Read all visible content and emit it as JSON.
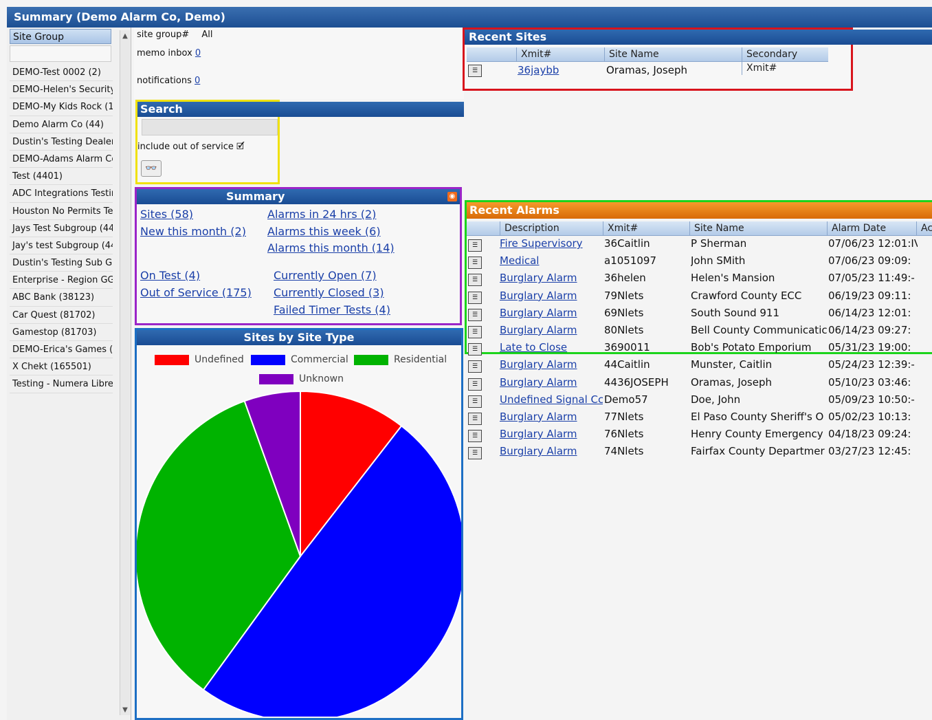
{
  "window": {
    "title": "Summary (Demo Alarm Co, Demo)"
  },
  "sidebar": {
    "header": "Site Group",
    "items": [
      "DEMO-Test 0002 (2)",
      "DEMO-Helen's Security",
      "DEMO-My Kids Rock (1",
      "Demo Alarm Co (44)",
      "Dustin's Testing Dealer (",
      "DEMO-Adams Alarm Co",
      "Test (4401)",
      "ADC Integrations Testing",
      "Houston No Permits Tes",
      "Jays Test Subgroup (44",
      "Jay's test Subgroup (44",
      "Dustin's Testing Sub Gro",
      "Enterprise - Region GG",
      "ABC Bank (38123)",
      "Car Quest (81702)",
      "Gamestop (81703)",
      "DEMO-Erica's Games (8",
      "X Chekt (165501)",
      "Testing - Numera Libre ("
    ]
  },
  "info": {
    "site_group_label": "site group#",
    "site_group_value": "All",
    "memo_label": "memo inbox",
    "memo_count": "0",
    "notif_label": "notifications",
    "notif_count": "0"
  },
  "search": {
    "title": "Search",
    "out_of_service_label": "include out of service",
    "checkbox": "🗹"
  },
  "summary": {
    "title": "Summary",
    "links": {
      "sites": "Sites (58)",
      "new_month": "New this month (2)",
      "alarms_24": "Alarms in 24 hrs (2)",
      "alarms_week": "Alarms this week (6)",
      "alarms_month": "Alarms this month (14)",
      "on_test": "On Test (4)",
      "out_service": "Out of Service (175)",
      "open": "Currently Open (7)",
      "closed": "Currently Closed (3)",
      "failed": "Failed Timer Tests (4)"
    }
  },
  "pie_panel": {
    "title": "Sites by Site Type"
  },
  "chart_data": {
    "type": "pie",
    "series": [
      {
        "name": "Undefined",
        "value": 10.5,
        "color": "#ff0000"
      },
      {
        "name": "Commercial",
        "value": 49.5,
        "color": "#0000ff"
      },
      {
        "name": "Residential",
        "value": 34.5,
        "color": "#00b300"
      },
      {
        "name": "Unknown",
        "value": 5.5,
        "color": "#7f00bf"
      }
    ],
    "legend": "top"
  },
  "recent_sites": {
    "title": "Recent Sites",
    "columns": [
      "Xmit#",
      "Site Name",
      "Secondary Xmit#"
    ],
    "rows": [
      {
        "xmit": "36jaybb",
        "site": "Oramas, Joseph",
        "secondary": ""
      }
    ]
  },
  "recent_alarms": {
    "title": "Recent Alarms",
    "columns": [
      "Description",
      "Xmit#",
      "Site Name",
      "Alarm Date",
      "Ac"
    ],
    "rows": [
      {
        "desc": "Fire Supervisory",
        "xmit": "36Caitlin",
        "site": "P Sherman",
        "date": "07/06/23 12:01:IV"
      },
      {
        "desc": "Medical",
        "xmit": "a1051097",
        "site": "John SMith",
        "date": "07/06/23 09:09:"
      },
      {
        "desc": "Burglary Alarm",
        "xmit": "36helen",
        "site": "Helen's Mansion",
        "date": "07/05/23 11:49:-"
      },
      {
        "desc": "Burglary Alarm",
        "xmit": "79Nlets",
        "site": "Crawford County ECC",
        "date": "06/19/23 09:11:"
      },
      {
        "desc": "Burglary Alarm",
        "xmit": "69Nlets",
        "site": "South Sound 911",
        "date": "06/14/23 12:01:"
      },
      {
        "desc": "Burglary Alarm",
        "xmit": "80Nlets",
        "site": "Bell County Communicatic",
        "date": "06/14/23 09:27:"
      },
      {
        "desc": "Late to Close",
        "xmit": "3690011",
        "site": "Bob's Potato Emporium",
        "date": "05/31/23 19:00:"
      },
      {
        "desc": "Burglary Alarm",
        "xmit": "44Caitlin",
        "site": "Munster, Caitlin",
        "date": "05/24/23 12:39:-"
      },
      {
        "desc": "Burglary Alarm",
        "xmit": "4436JOSEPH",
        "site": "Oramas, Joseph",
        "date": "05/10/23 03:46:"
      },
      {
        "desc": "Undefined Signal Cc",
        "xmit": "Demo57",
        "site": "Doe, John",
        "date": "05/09/23 10:50:-"
      },
      {
        "desc": "Burglary Alarm",
        "xmit": "77Nlets",
        "site": "El Paso County Sheriff's O",
        "date": "05/02/23 10:13:"
      },
      {
        "desc": "Burglary Alarm",
        "xmit": "76Nlets",
        "site": "Henry County Emergency",
        "date": "04/18/23 09:24:"
      },
      {
        "desc": "Burglary Alarm",
        "xmit": "74Nlets",
        "site": "Fairfax County Departmer",
        "date": "03/27/23 12:45:"
      }
    ]
  }
}
